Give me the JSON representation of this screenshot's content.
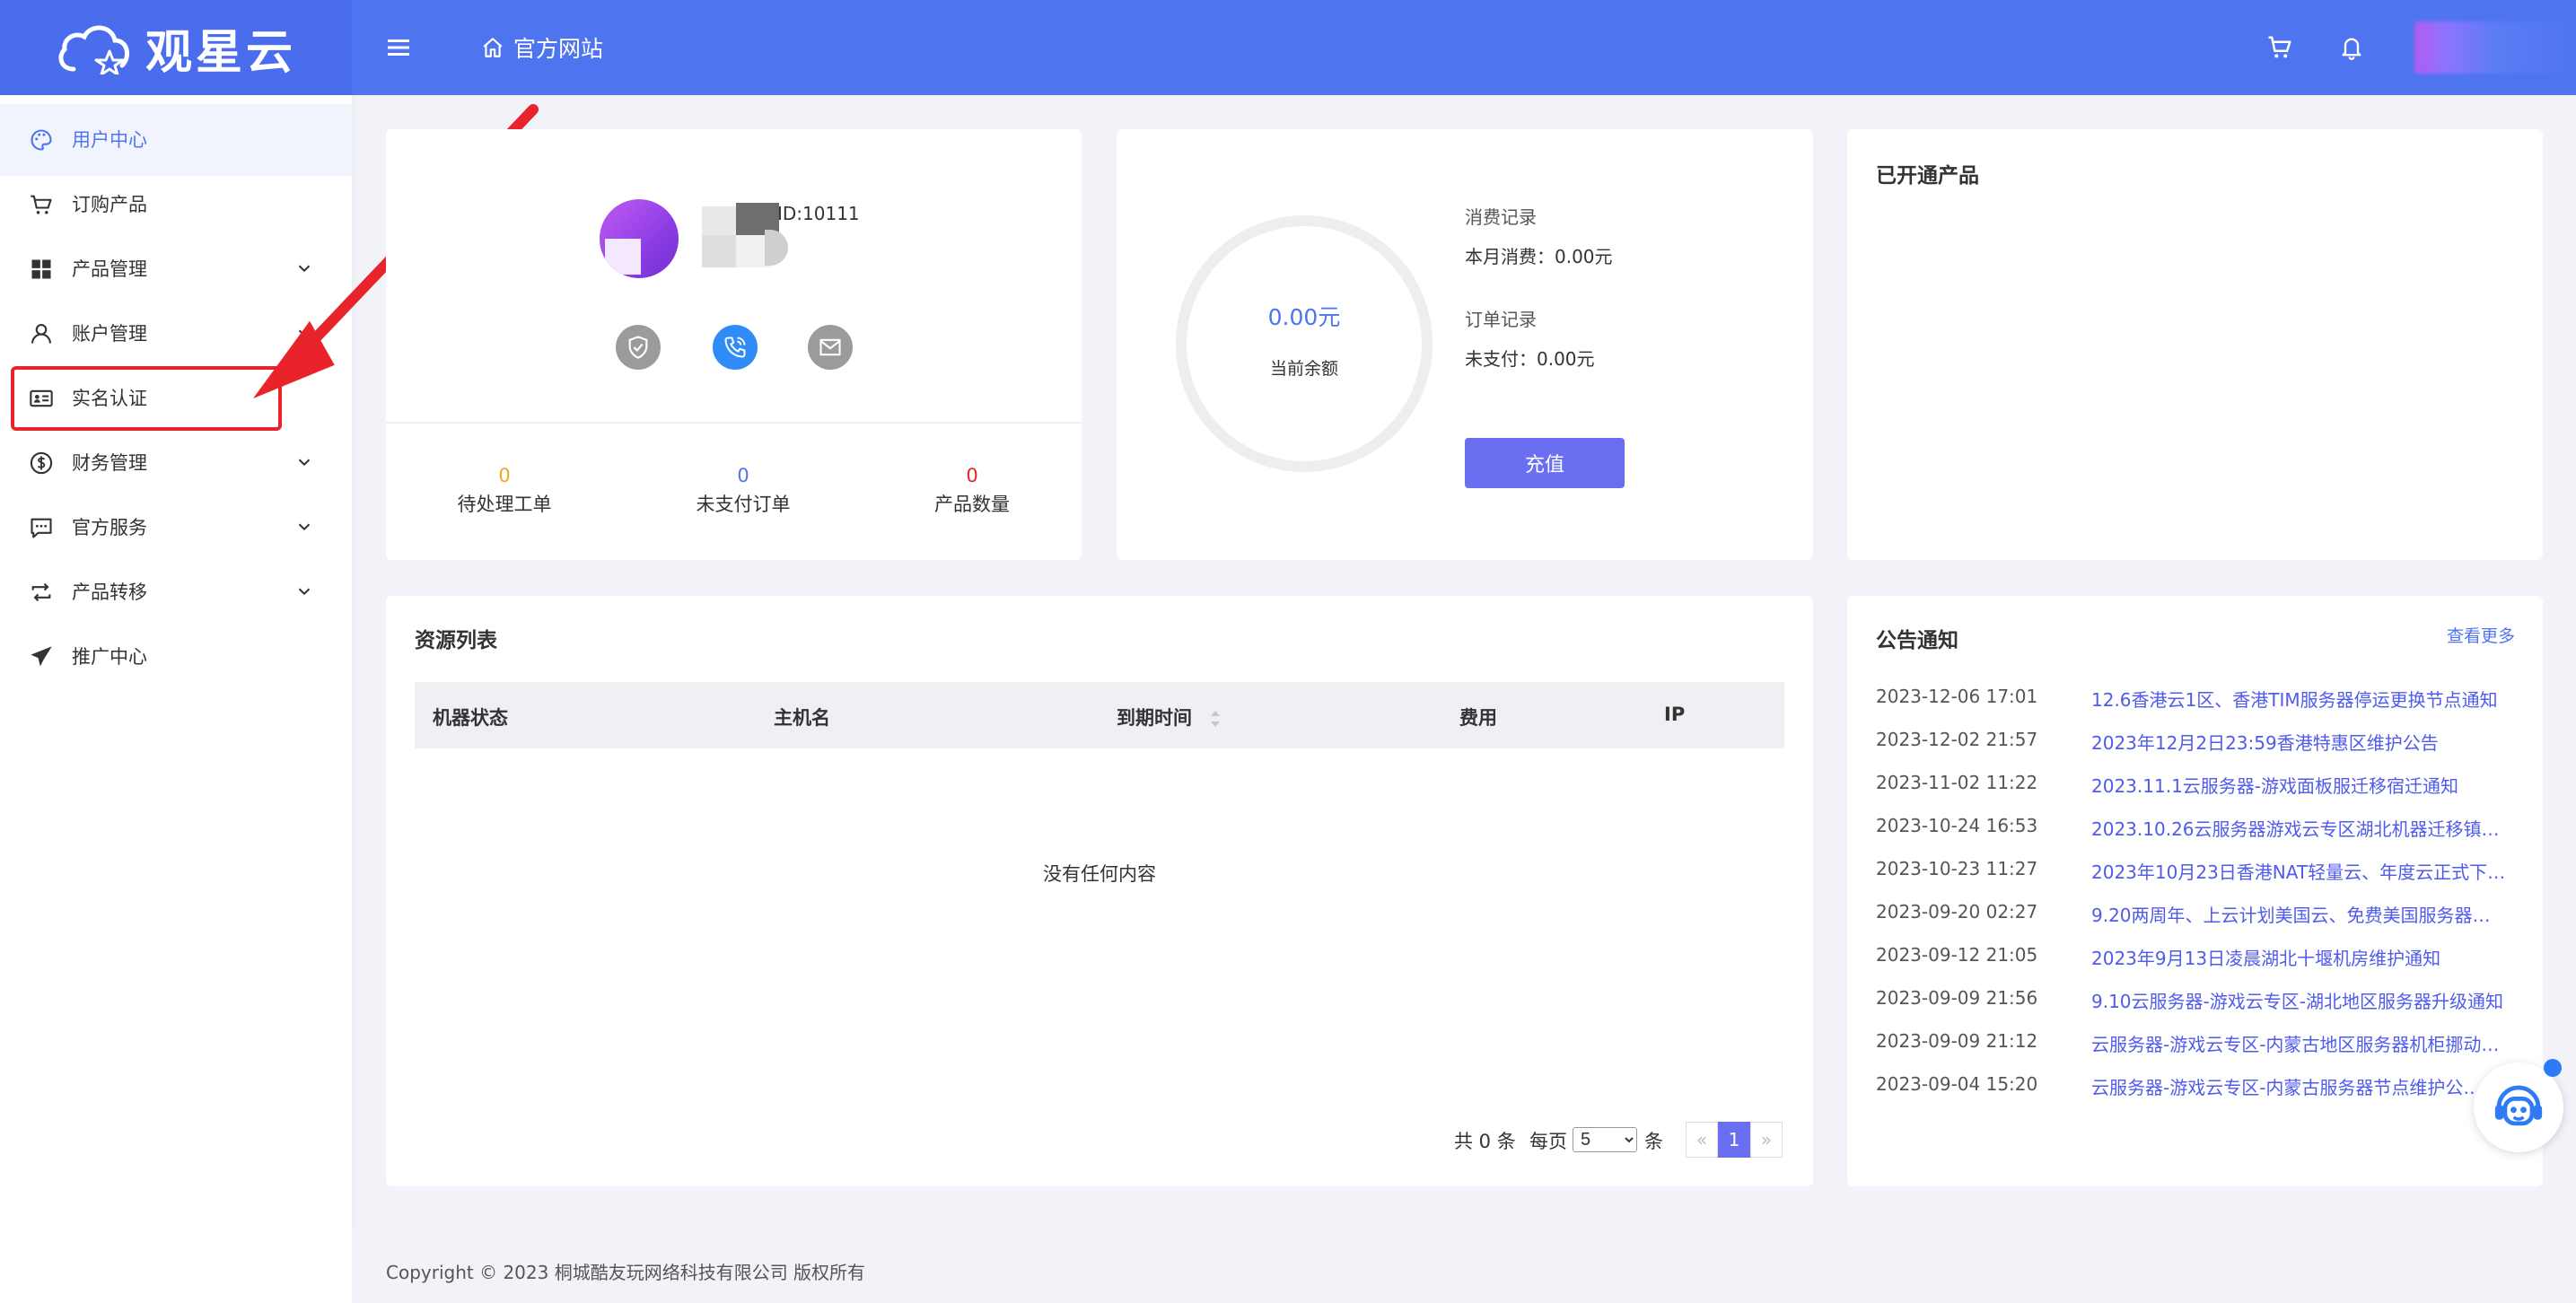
{
  "brand": {
    "name": "观星云",
    "accent": "#4f74f0",
    "header_left": "#4a6ded"
  },
  "topbar": {
    "home_label": "官方网站",
    "icons": [
      "menu-icon",
      "home-icon",
      "cart-icon",
      "bell-icon"
    ]
  },
  "sidebar": {
    "items": [
      {
        "label": "用户中心",
        "icon": "palette-icon",
        "active": true,
        "expandable": false
      },
      {
        "label": "订购产品",
        "icon": "cart-icon",
        "active": false,
        "expandable": false
      },
      {
        "label": "产品管理",
        "icon": "grid-icon",
        "active": false,
        "expandable": true
      },
      {
        "label": "账户管理",
        "icon": "user-icon",
        "active": false,
        "expandable": true
      },
      {
        "label": "实名认证",
        "icon": "id-card-icon",
        "active": false,
        "expandable": false
      },
      {
        "label": "财务管理",
        "icon": "dollar-icon",
        "active": false,
        "expandable": true
      },
      {
        "label": "官方服务",
        "icon": "chat-icon",
        "active": false,
        "expandable": true
      },
      {
        "label": "产品转移",
        "icon": "transfer-icon",
        "active": false,
        "expandable": true
      },
      {
        "label": "推广中心",
        "icon": "send-icon",
        "active": false,
        "expandable": false
      }
    ],
    "highlight_color": "#e8242a"
  },
  "profile": {
    "uid": "ID:10111",
    "stats": [
      {
        "value": "0",
        "label": "待处理工单",
        "color": "#f5a623"
      },
      {
        "value": "0",
        "label": "未支付订单",
        "color": "#4f74f0"
      },
      {
        "value": "0",
        "label": "产品数量",
        "color": "#e8242a"
      }
    ]
  },
  "balance": {
    "amount": "0.00元",
    "amount_label": "当前余额",
    "consume_title": "消费记录",
    "consume_value": "本月消费：0.00元",
    "order_title": "订单记录",
    "order_value": "未支付：0.00元",
    "recharge_label": "充值"
  },
  "products": {
    "title": "已开通产品"
  },
  "resources": {
    "title": "资源列表",
    "columns": [
      "机器状态",
      "主机名",
      "到期时间",
      "费用",
      "IP"
    ],
    "empty_text": "没有任何内容",
    "total_text": "共 0 条",
    "per_page_label": "每页",
    "per_page_value": "5",
    "per_page_unit": "条",
    "current_page": "1",
    "prev": "«",
    "next": "»"
  },
  "notices": {
    "title": "公告通知",
    "more": "查看更多",
    "items": [
      {
        "date": "2023-12-06 17:01",
        "title": "12.6香港云1区、香港TIM服务器停运更换节点通知"
      },
      {
        "date": "2023-12-02 21:57",
        "title": "2023年12月2日23:59香港特惠区维护公告"
      },
      {
        "date": "2023-11-02 11:22",
        "title": "2023.11.1云服务器-游戏面板服迁移宿迁通知"
      },
      {
        "date": "2023-10-24 16:53",
        "title": "2023.10.26云服务器游戏云专区湖北机器迁移镇…"
      },
      {
        "date": "2023-10-23 11:27",
        "title": "2023年10月23日香港NAT轻量云、年度云正式下…"
      },
      {
        "date": "2023-09-20 02:27",
        "title": "9.20两周年、上云计划美国云、免费美国服务器…"
      },
      {
        "date": "2023-09-12 21:05",
        "title": "2023年9月13日凌晨湖北十堰机房维护通知"
      },
      {
        "date": "2023-09-09 21:56",
        "title": "9.10云服务器-游戏云专区-湖北地区服务器升级通知"
      },
      {
        "date": "2023-09-09 21:12",
        "title": "云服务器-游戏云专区-内蒙古地区服务器机柜挪动…"
      },
      {
        "date": "2023-09-04 15:20",
        "title": "云服务器-游戏云专区-内蒙古服务器节点维护公…"
      }
    ]
  },
  "footer": {
    "copyright": "Copyright © 2023 桐城酷友玩网络科技有限公司 版权所有"
  }
}
